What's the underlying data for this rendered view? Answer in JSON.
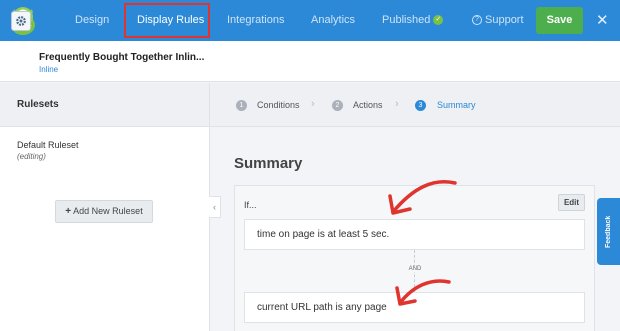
{
  "nav": {
    "items": [
      "Design",
      "Display Rules",
      "Integrations",
      "Analytics",
      "Published",
      "Support"
    ],
    "save_label": "Save",
    "close_glyph": "✕",
    "published_badge_glyph": "✓",
    "support_icon_glyph": "?",
    "accent_color": "#2b89d8",
    "highlight_color": "#e0342f"
  },
  "campaign": {
    "title": "Frequently Bought Together Inlin...",
    "type": "Inline",
    "icon": "gear-icon"
  },
  "rulesets": {
    "heading": "Rulesets",
    "items": [
      {
        "name": "Default Ruleset",
        "state": "(editing)"
      }
    ],
    "add_label": "Add New Ruleset",
    "add_icon_glyph": "+",
    "collapse_glyph": "‹"
  },
  "steps": [
    {
      "num": "1",
      "label": "Conditions"
    },
    {
      "num": "2",
      "label": "Actions"
    },
    {
      "num": "3",
      "label": "Summary"
    }
  ],
  "steps_separator": "›",
  "summary": {
    "title": "Summary",
    "if_label": "If...",
    "edit_label": "Edit",
    "conditions": [
      "time on page is at least 5 sec.",
      "current URL path is any page"
    ],
    "joiner": "AND"
  },
  "feedback_label": "Feedback"
}
